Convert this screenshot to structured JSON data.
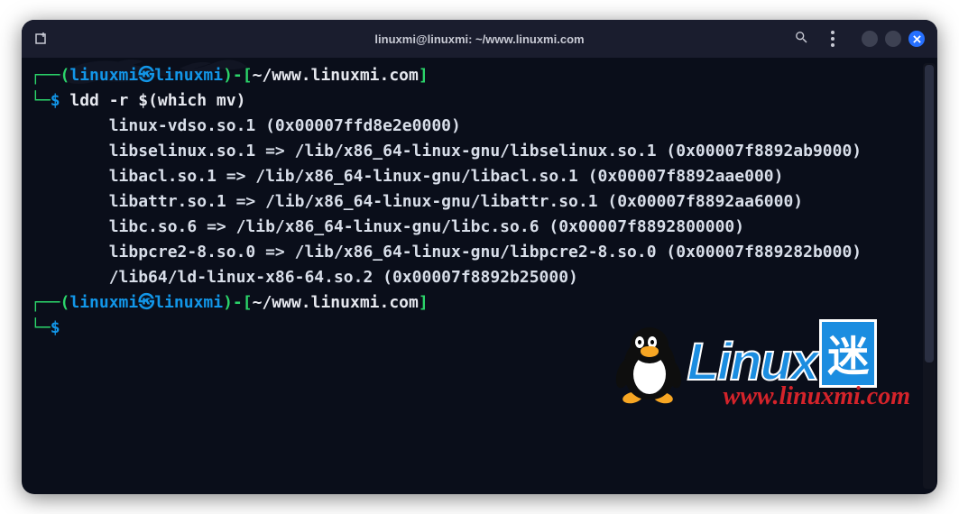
{
  "titlebar": {
    "title": "linuxmi@linuxmi: ~/www.linuxmi.com"
  },
  "icons": {
    "new_tab": "new-tab-icon",
    "search": "search-icon",
    "kebab": "kebab-menu-icon",
    "minimize": "minimize-icon",
    "maximize": "maximize-icon",
    "close": "close-icon"
  },
  "prompt": {
    "open_paren": "(",
    "user": "linuxmi",
    "at": "㉿",
    "host": "linuxmi",
    "close_paren": ")",
    "dash": "-[",
    "path": "~/www.linuxmi.com",
    "close_bracket": "]",
    "corner_top": "┌──",
    "corner_bot": "└─",
    "dollar": "$"
  },
  "command": "ldd -r $(which mv)",
  "output": [
    "        linux-vdso.so.1 (0x00007ffd8e2e0000)",
    "        libselinux.so.1 => /lib/x86_64-linux-gnu/libselinux.so.1 (0x00007f8892ab9000)",
    "        libacl.so.1 => /lib/x86_64-linux-gnu/libacl.so.1 (0x00007f8892aae000)",
    "        libattr.so.1 => /lib/x86_64-linux-gnu/libattr.so.1 (0x00007f8892aa6000)",
    "        libc.so.6 => /lib/x86_64-linux-gnu/libc.so.6 (0x00007f8892800000)",
    "        libpcre2-8.so.0 => /lib/x86_64-linux-gnu/libpcre2-8.so.0 (0x00007f889282b000)",
    "        /lib64/ld-linux-x86-64.so.2 (0x00007f8892b25000)"
  ],
  "watermark": {
    "brand_linux": "Linux",
    "brand_mi": "迷",
    "url": "www.linuxmi.com"
  }
}
